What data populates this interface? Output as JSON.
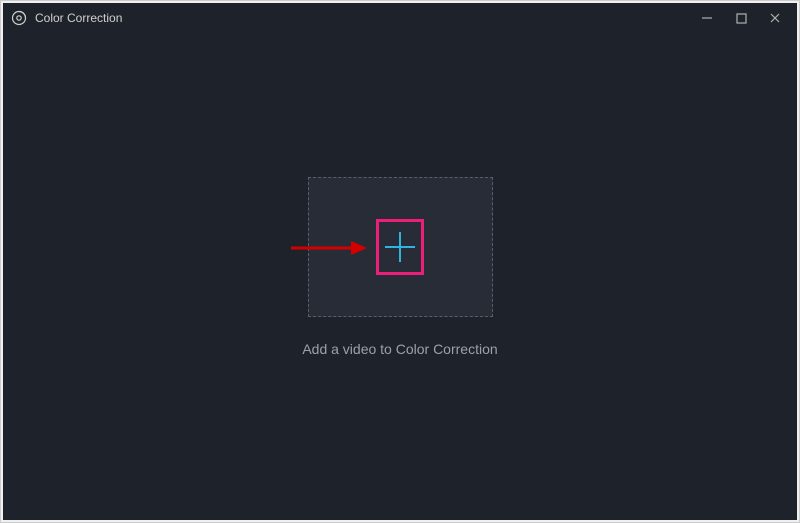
{
  "window": {
    "title": "Color Correction"
  },
  "main": {
    "caption": "Add a video to Color Correction"
  },
  "icons": {
    "app": "app-icon",
    "minimize": "minimize",
    "maximize": "maximize",
    "close": "close",
    "plus": "plus"
  },
  "colors": {
    "accent_cyan": "#2fb3e0",
    "highlight_magenta": "#ed1e79",
    "arrow_red": "#d40000"
  }
}
